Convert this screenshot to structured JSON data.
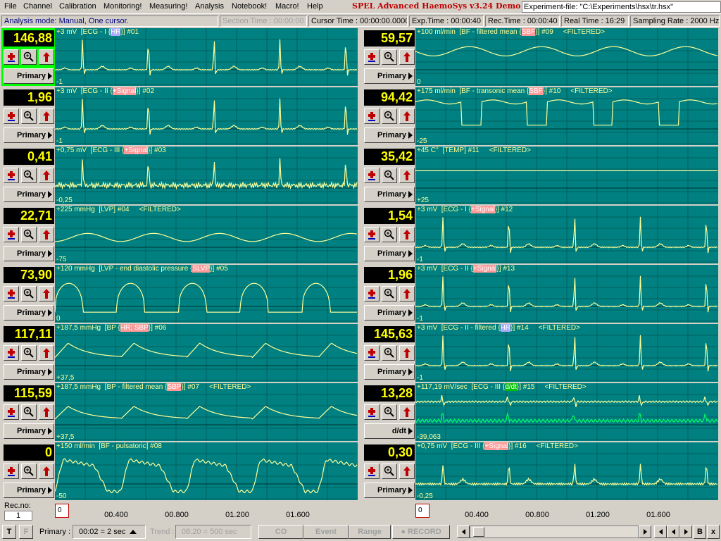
{
  "menu": [
    {
      "label": "File"
    },
    {
      "label": "Channel"
    },
    {
      "label": "Calibration"
    },
    {
      "label": "Monitoring!"
    },
    {
      "label": "Measuring!"
    },
    {
      "label": "Analysis"
    },
    {
      "label": "Notebook!"
    },
    {
      "label": "Macro!"
    },
    {
      "label": "Help"
    }
  ],
  "app_title": "SPEL Advanced HaemoSys v3.24 Demo",
  "experiment_file": "Experiment-file: \"C:\\Experiments\\hsx\\tr.hsx\"",
  "status": {
    "mode": "Analysis mode: Manual, One cursor.",
    "section_time": "Section Time : 00:00:00",
    "cursor_time": "Cursor Time : 00:00:00.0000",
    "exp_time": "Exp.Time : 00:00:40",
    "rec_time": "Rec.Time : 00:00:40",
    "real_time": "Real Time : 16:29",
    "sampling_rate": "Sampling Rate : 2000 Hz"
  },
  "channels": [
    {
      "value": "146,88",
      "max": "+3",
      "unit": "mV",
      "name": "ECG - I",
      "tag": "HR",
      "tag_color": "blue",
      "num": "#01",
      "min": "-1",
      "filtered": false,
      "mode": "Primary",
      "wave": "ecg",
      "selected": true
    },
    {
      "value": "1,96",
      "max": "+3",
      "unit": "mV",
      "name": "ECG - II",
      "tag": "+Signal",
      "tag_color": "red",
      "num": "#02",
      "min": "-1",
      "filtered": false,
      "mode": "Primary",
      "wave": "ecg"
    },
    {
      "value": "0,41",
      "max": "+0,75",
      "unit": "mV",
      "name": "ECG - III",
      "tag": "+Signal",
      "tag_color": "red",
      "num": "#03",
      "min": "-0,25",
      "filtered": false,
      "mode": "Primary",
      "wave": "ecgnoise"
    },
    {
      "value": "22,71",
      "max": "+225",
      "unit": "mmHg",
      "name": "LVP",
      "tag": "",
      "num": "#04",
      "min": "-75",
      "filtered": true,
      "mode": "Primary",
      "wave": "lvp"
    },
    {
      "value": "73,90",
      "max": "+120",
      "unit": "mmHg",
      "name": "LVP - end diastolic pressure",
      "tag": "SLVP",
      "tag_color": "red",
      "num": "#05",
      "min": "0",
      "filtered": false,
      "mode": "Primary",
      "wave": "lvp2"
    },
    {
      "value": "117,11",
      "max": "+187,5",
      "unit": "mmHg",
      "name": "BP",
      "tag": "HR; SBP",
      "tag_color": "red",
      "num": "#06",
      "min": "+37,5",
      "filtered": false,
      "mode": "Primary",
      "wave": "bp"
    },
    {
      "value": "115,59",
      "max": "+187,5",
      "unit": "mmHg",
      "name": "BP - filtered mean",
      "tag": "SBP",
      "tag_color": "red",
      "num": "#07",
      "min": "+37,5",
      "filtered": true,
      "mode": "Primary",
      "wave": "bp2"
    },
    {
      "value": "0",
      "max": "+150",
      "unit": "ml/min",
      "name": "BF - pulsatoric",
      "tag": "",
      "num": "#08",
      "min": "-50",
      "filtered": false,
      "mode": "Primary",
      "wave": "bf"
    },
    {
      "value": "59,57",
      "max": "+100",
      "unit": "ml/min",
      "name": "BF - filtered mean",
      "tag": "SBF",
      "tag_color": "red",
      "num": "#09",
      "min": "0",
      "filtered": true,
      "mode": "Primary",
      "wave": "sine"
    },
    {
      "value": "94,42",
      "max": "+175",
      "unit": "ml/min",
      "name": "BF - transonic mean",
      "tag": "SBF",
      "tag_color": "red",
      "num": "#10",
      "min": "-25",
      "filtered": true,
      "mode": "Primary",
      "wave": "bf2"
    },
    {
      "value": "35,42",
      "max": "+45",
      "unit": "C°",
      "name": "TEMP",
      "tag": "",
      "num": "#11",
      "min": "+25",
      "filtered": true,
      "mode": "Primary",
      "wave": "flat"
    },
    {
      "value": "1,54",
      "max": "+3",
      "unit": "mV",
      "name": "ECG - I",
      "tag": "+Signal",
      "tag_color": "red",
      "num": "#12",
      "min": "-1",
      "filtered": false,
      "mode": "Primary",
      "wave": "ecg"
    },
    {
      "value": "1,96",
      "max": "+3",
      "unit": "mV",
      "name": "ECG - II",
      "tag": "+Signal",
      "tag_color": "red",
      "num": "#13",
      "min": "-1",
      "filtered": false,
      "mode": "Primary",
      "wave": "ecg"
    },
    {
      "value": "145,63",
      "max": "+3",
      "unit": "mV",
      "name": "ECG - II - filtered",
      "tag": "HR",
      "tag_color": "blue",
      "num": "#14",
      "min": "-1",
      "filtered": true,
      "mode": "Primary",
      "wave": "ecg"
    },
    {
      "value": "13,28",
      "max": "+117,19",
      "unit": "mV/sec",
      "name": "ECG - III",
      "tag": "d/dt",
      "tag_color": "green",
      "num": "#15",
      "min": "-39,063",
      "filtered": true,
      "mode": "d/dt",
      "wave": "deriv"
    },
    {
      "value": "0,30",
      "max": "+0,75",
      "unit": "mV",
      "name": "ECG - III",
      "tag": "+Signal",
      "tag_color": "red",
      "num": "#16",
      "min": "-0,25",
      "filtered": true,
      "mode": "Primary",
      "wave": "ecgsmall"
    }
  ],
  "rec_no_label": "Rec.no:",
  "rec_no": "1",
  "axis": {
    "start": "0",
    "ticks": [
      "00.400",
      "00.800",
      "01.200",
      "01.600"
    ]
  },
  "bottom": {
    "t_label": "T",
    "f_label": "F",
    "primary_label": "Primary :",
    "primary_value": "00:02 = 2 sec",
    "trend_label": "Trend :",
    "trend_value": "08:20 = 500 sec",
    "co": "CO",
    "event": "Event",
    "range": "Range",
    "record": "● RECORD",
    "b": "B",
    "x": "x"
  },
  "colors": {
    "trace": "#ffff99",
    "graph_bg": "#008080",
    "deriv": "#00ff66",
    "value_text": "#ffff00",
    "grid": "#006060"
  }
}
